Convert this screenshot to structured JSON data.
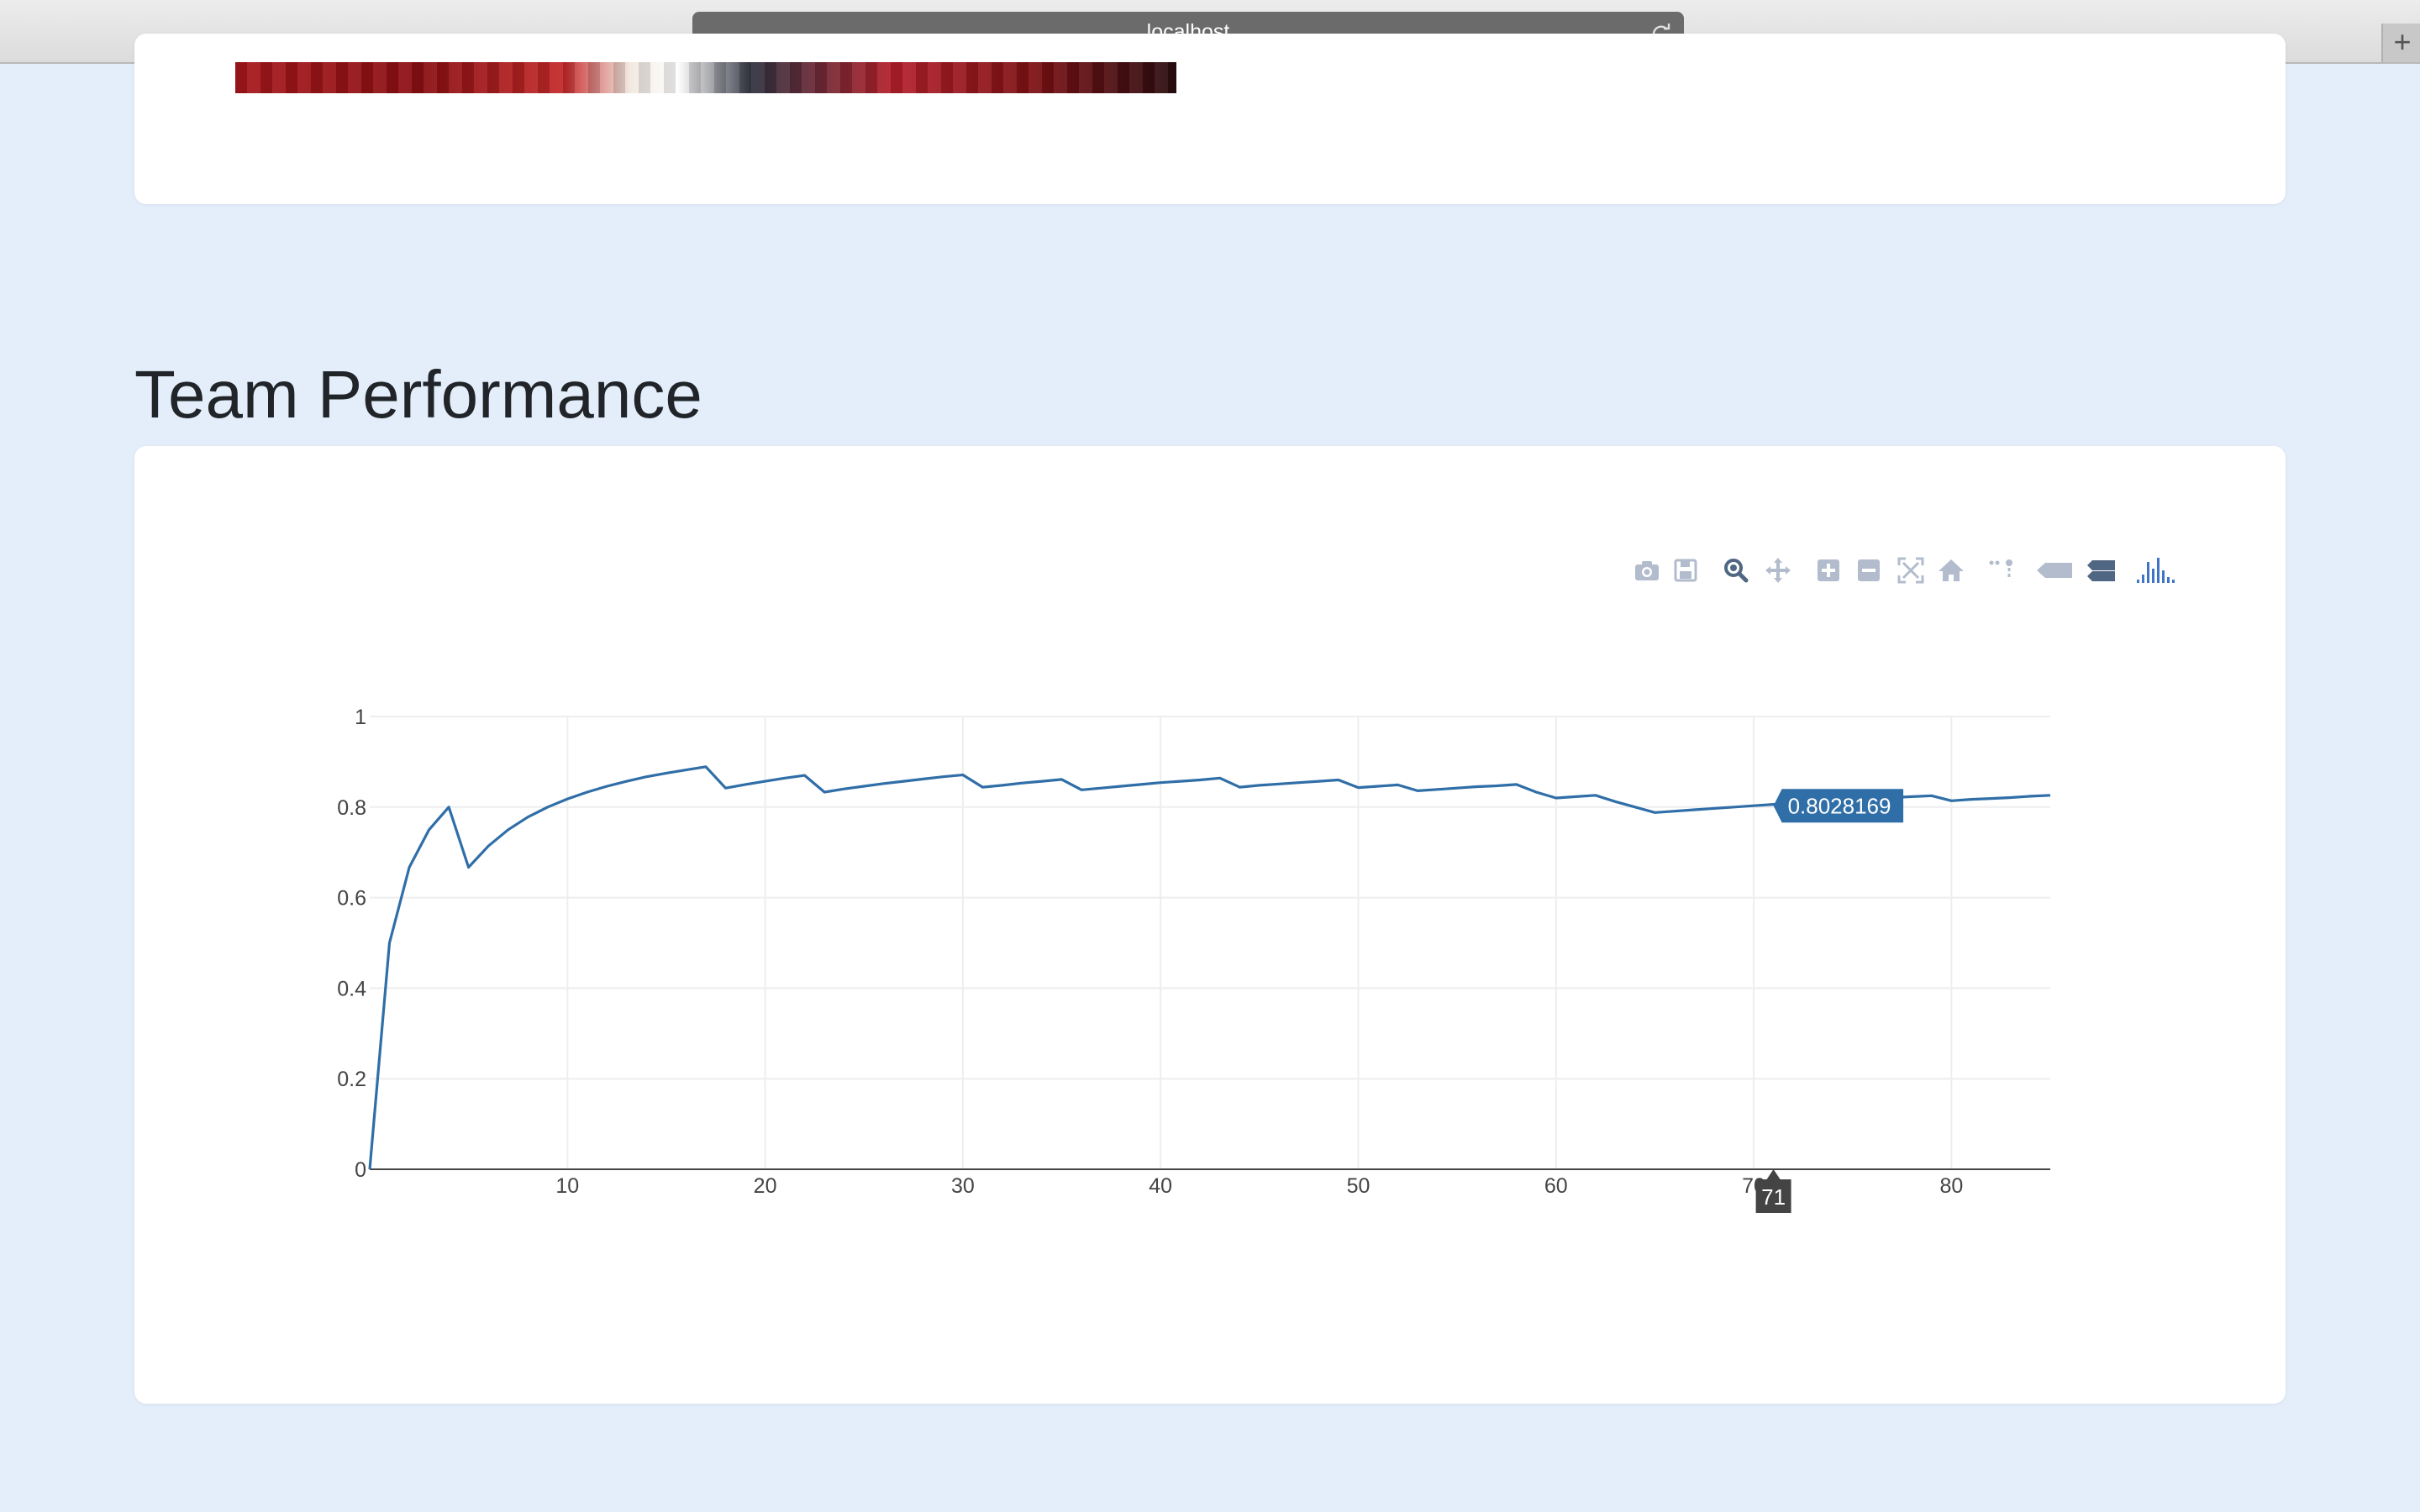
{
  "browser": {
    "url": "localhost",
    "new_tab_label": "+"
  },
  "section": {
    "title": "Team Performance"
  },
  "modebar": {
    "icons": [
      "camera-icon",
      "save-icon",
      "zoom-icon",
      "pan-icon",
      "zoom-in-icon",
      "zoom-out-icon",
      "autoscale-icon",
      "home-icon",
      "spike-lines-icon",
      "hover-closest-icon",
      "hover-compare-icon",
      "plotly-logo-icon"
    ]
  },
  "colors": {
    "background": "#e3eefa",
    "line": "#2f6ea7",
    "modebar_icon": "#b3bccd",
    "logo": "#3f74c9"
  },
  "hover": {
    "x_label": "71",
    "y_label": "0.8028169"
  },
  "chart_data": {
    "type": "line",
    "xlim": [
      0,
      85
    ],
    "ylim": [
      0,
      1
    ],
    "xticks": [
      10,
      20,
      30,
      40,
      50,
      60,
      70,
      80
    ],
    "xtick_labels": [
      "10",
      "20",
      "30",
      "40",
      "50",
      "60",
      "70",
      "80"
    ],
    "yticks": [
      0,
      0.2,
      0.4,
      0.6,
      0.8,
      1
    ],
    "ytick_labels": [
      "0",
      "0.2",
      "0.4",
      "0.6",
      "0.8",
      "1"
    ],
    "grid": true,
    "series": [
      {
        "x": [
          0,
          1,
          2,
          3,
          4,
          5,
          6,
          7,
          8,
          9,
          10,
          11,
          12,
          13,
          14,
          15,
          16,
          17,
          18,
          19,
          20,
          21,
          22,
          23,
          24,
          25,
          26,
          27,
          28,
          29,
          30,
          31,
          32,
          33,
          34,
          35,
          36,
          37,
          38,
          39,
          40,
          41,
          42,
          43,
          44,
          45,
          46,
          47,
          48,
          49,
          50,
          51,
          52,
          53,
          54,
          55,
          56,
          57,
          58,
          59,
          60,
          61,
          62,
          63,
          64,
          65,
          66,
          67,
          68,
          69,
          70,
          71,
          72,
          73,
          74,
          75,
          76,
          77,
          78,
          79,
          80,
          81,
          82,
          83,
          84,
          85
        ],
        "y": [
          0,
          0.5,
          0.667,
          0.75,
          0.8,
          0.667,
          0.714,
          0.75,
          0.778,
          0.8,
          0.818,
          0.833,
          0.846,
          0.857,
          0.867,
          0.875,
          0.882,
          0.889,
          0.842,
          0.85,
          0.857,
          0.864,
          0.87,
          0.833,
          0.84,
          0.846,
          0.852,
          0.857,
          0.862,
          0.867,
          0.871,
          0.844,
          0.848,
          0.853,
          0.857,
          0.861,
          0.838,
          0.842,
          0.846,
          0.85,
          0.854,
          0.857,
          0.86,
          0.864,
          0.844,
          0.848,
          0.851,
          0.854,
          0.857,
          0.86,
          0.843,
          0.846,
          0.849,
          0.836,
          0.839,
          0.842,
          0.845,
          0.847,
          0.85,
          0.833,
          0.82,
          0.823,
          0.826,
          0.812,
          0.8,
          0.788,
          0.791,
          0.794,
          0.797,
          0.8,
          0.803,
          0.806,
          0.808,
          0.811,
          0.813,
          0.816,
          0.818,
          0.821,
          0.823,
          0.825,
          0.814,
          0.817,
          0.819,
          0.821,
          0.824,
          0.826
        ]
      }
    ]
  }
}
